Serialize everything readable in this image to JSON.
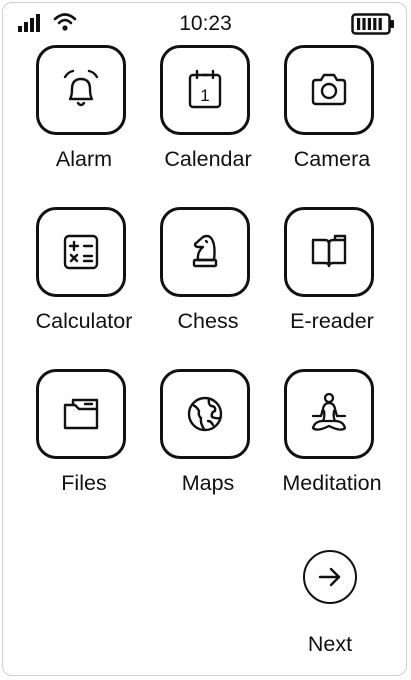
{
  "status_bar": {
    "time": "10:23",
    "signal_icon": "cellular-signal-icon",
    "wifi_icon": "wifi-icon",
    "battery_icon": "battery-full-icon"
  },
  "apps": [
    {
      "label": "Alarm",
      "icon": "bell-icon"
    },
    {
      "label": "Calendar",
      "icon": "calendar-icon",
      "calendar_day": "1"
    },
    {
      "label": "Camera",
      "icon": "camera-icon"
    },
    {
      "label": "Calculator",
      "icon": "calculator-icon"
    },
    {
      "label": "Chess",
      "icon": "chess-knight-icon"
    },
    {
      "label": "E-reader",
      "icon": "book-icon"
    },
    {
      "label": "Files",
      "icon": "folder-icon"
    },
    {
      "label": "Maps",
      "icon": "globe-icon"
    },
    {
      "label": "Meditation",
      "icon": "meditation-icon"
    }
  ],
  "next": {
    "label": "Next",
    "icon": "arrow-right-circle-icon"
  }
}
